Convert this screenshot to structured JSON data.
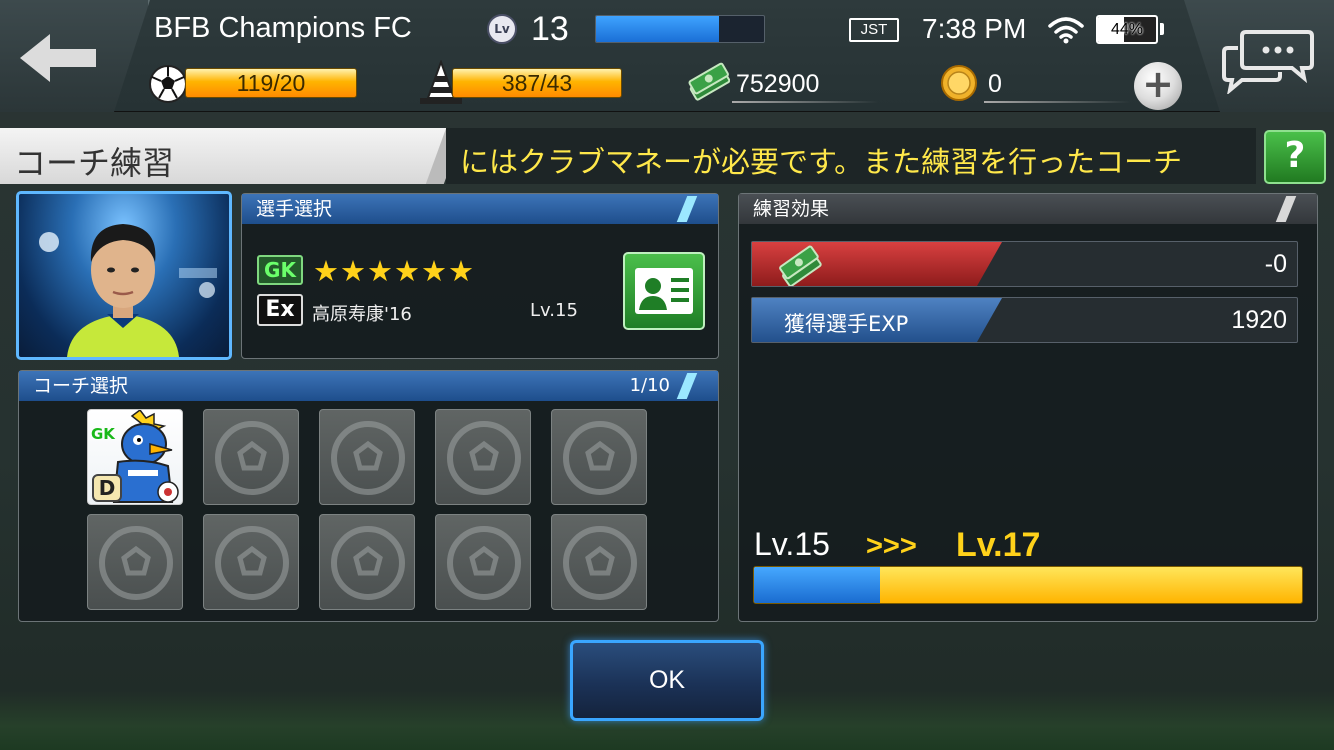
{
  "header": {
    "team_name": "BFB Champions FC",
    "level_badge": "Lv",
    "level": "13",
    "level_progress": 0.73,
    "timezone": "JST",
    "time": "7:38 PM",
    "battery": "44%",
    "battery_level": 0.44,
    "resources": {
      "balls": "119/20",
      "cones": "387/43",
      "money": "752900",
      "coins": "0"
    },
    "plus_label": "+"
  },
  "title": "コーチ練習",
  "ticker": "にはクラブマネーが必要です。また練習を行ったコーチ",
  "help_label": "?",
  "player_select": {
    "header": "選手選択",
    "position": "GK",
    "stars": "★★★★★★",
    "star_count": 6,
    "rarity": "Ex",
    "name": "高原寿康'16",
    "level": "Lv.15"
  },
  "coach_select": {
    "header": "コーチ選択",
    "count": "1/10",
    "coach_position": "GK",
    "coach_rank": "D"
  },
  "effects": {
    "header": "練習効果",
    "money_cost": "-0",
    "exp_label": "獲得選手EXP",
    "exp_value": "1920"
  },
  "level_up": {
    "from": "Lv.15",
    "arrows": ">>>",
    "to": "Lv.17",
    "current_fraction": 0.23
  },
  "ok_label": "OK",
  "colors": {
    "accent_blue": "#3aa6ff",
    "gold": "#ffd21a",
    "ticker_text": "#ffe84a",
    "red_effect": "#d84040",
    "green_button": "#4bbf4b"
  }
}
